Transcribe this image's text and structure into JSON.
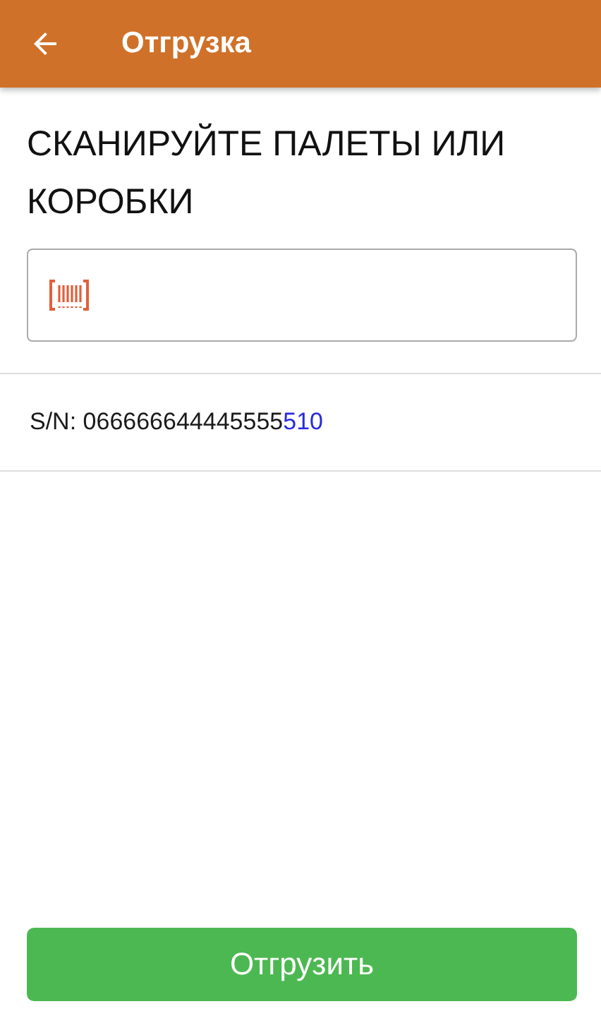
{
  "app_bar": {
    "title": "Отгрузка"
  },
  "prompt": "СКАНИРУЙТЕ ПАЛЕТЫ ИЛИ КОРОБКИ",
  "items": [
    {
      "text": "S/N: 066666644445555",
      "highlight": "510"
    }
  ],
  "buttons": [
    "Отгрузить"
  ]
}
